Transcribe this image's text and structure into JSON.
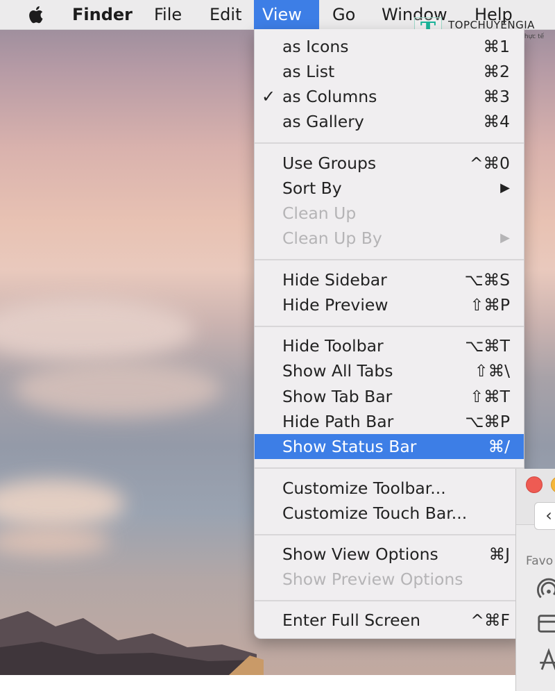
{
  "menubar": {
    "apple_icon": "apple-logo-icon",
    "items": [
      {
        "label": "Finder",
        "bold": true
      },
      {
        "label": "File"
      },
      {
        "label": "Edit"
      },
      {
        "label": "View",
        "active": true
      },
      {
        "label": "Go"
      },
      {
        "label": "Window"
      },
      {
        "label": "Help"
      }
    ]
  },
  "watermark": {
    "letter": "T",
    "title": "TOPCHUYENGIA",
    "subtitle": "Tư vấn từ kinh nghiệm thực tế"
  },
  "view_menu": {
    "groups": [
      [
        {
          "label": "as Icons",
          "shortcut": "⌘1"
        },
        {
          "label": "as List",
          "shortcut": "⌘2"
        },
        {
          "label": "as Columns",
          "shortcut": "⌘3",
          "checked": true
        },
        {
          "label": "as Gallery",
          "shortcut": "⌘4"
        }
      ],
      [
        {
          "label": "Use Groups",
          "shortcut": "^⌘0"
        },
        {
          "label": "Sort By",
          "shortcut": "▶",
          "submenu": true
        },
        {
          "label": "Clean Up",
          "shortcut": "",
          "disabled": true
        },
        {
          "label": "Clean Up By",
          "shortcut": "▶",
          "disabled": true,
          "submenu": true
        }
      ],
      [
        {
          "label": "Hide Sidebar",
          "shortcut": "⌥⌘S"
        },
        {
          "label": "Hide Preview",
          "shortcut": "⇧⌘P"
        }
      ],
      [
        {
          "label": "Hide Toolbar",
          "shortcut": "⌥⌘T"
        },
        {
          "label": "Show All Tabs",
          "shortcut": "⇧⌘\\"
        },
        {
          "label": "Show Tab Bar",
          "shortcut": "⇧⌘T"
        },
        {
          "label": "Hide Path Bar",
          "shortcut": "⌥⌘P"
        },
        {
          "label": "Show Status Bar",
          "shortcut": "⌘/",
          "selected": true
        }
      ],
      [
        {
          "label": "Customize Toolbar...",
          "shortcut": ""
        },
        {
          "label": "Customize Touch Bar...",
          "shortcut": ""
        }
      ],
      [
        {
          "label": "Show View Options",
          "shortcut": "⌘J"
        },
        {
          "label": "Show Preview Options",
          "shortcut": "",
          "disabled": true
        }
      ],
      [
        {
          "label": "Enter Full Screen",
          "shortcut": "^⌘F"
        }
      ]
    ],
    "check_mark": "✓"
  },
  "finder_window": {
    "back_symbol": "‹",
    "sidebar_heading": "Favo",
    "icons": [
      "airdrop-icon",
      "recents-icon",
      "applications-icon"
    ]
  },
  "colors": {
    "accent": "#3d7ee6",
    "close": "#ee5b53",
    "minimize": "#f5b73b"
  }
}
